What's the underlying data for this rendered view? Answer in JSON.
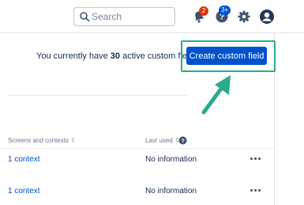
{
  "header": {
    "search": {
      "placeholder": "Search",
      "value": ""
    },
    "notifications": {
      "badge": "2",
      "badge_color": "#de350b"
    },
    "help": {
      "badge": "3+",
      "badge_color": "#0052cc"
    },
    "icons": [
      "search-icon",
      "bell-icon",
      "help-icon",
      "gear-icon",
      "profile-icon"
    ]
  },
  "summary": {
    "prefix": "You currently have",
    "count": "30",
    "suffix": "active custom fields"
  },
  "create_button": {
    "label": "Create custom field",
    "color": "#0052cc"
  },
  "highlight_color": "#2bab8f",
  "table": {
    "columns": [
      {
        "label": "Screens and contexts",
        "sort": "⇕"
      },
      {
        "label": "Last used",
        "sort": "⇕"
      }
    ],
    "rows": [
      {
        "context": "1 context",
        "last_used": "No information"
      },
      {
        "context": "1 context",
        "last_used": "No information"
      }
    ]
  }
}
